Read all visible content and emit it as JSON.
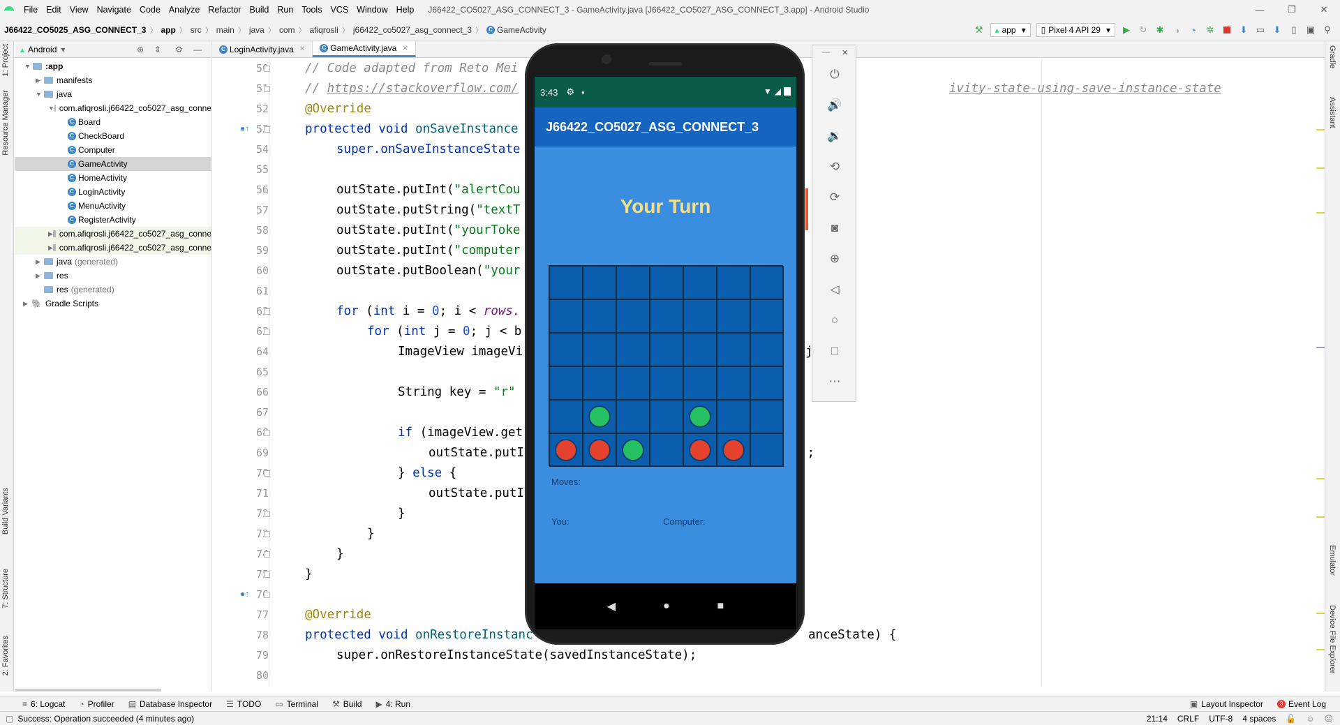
{
  "window": {
    "title": "J66422_CO5027_ASG_CONNECT_3 - GameActivity.java [J66422_CO5027_ASG_CONNECT_3.app] - Android Studio",
    "minimize": "—",
    "restore": "❐",
    "close": "✕"
  },
  "menu": [
    "File",
    "Edit",
    "View",
    "Navigate",
    "Code",
    "Analyze",
    "Refactor",
    "Build",
    "Run",
    "Tools",
    "VCS",
    "Window",
    "Help"
  ],
  "breadcrumbs": [
    "J66422_CO5025_ASG_CONNECT_3",
    "app",
    "src",
    "main",
    "java",
    "com",
    "afiqrosli",
    "j66422_co5027_asg_connect_3",
    "GameActivity"
  ],
  "toolbar": {
    "run_config": "app",
    "device": "Pixel 4 API 29"
  },
  "left_tabs": {
    "project": "1: Project",
    "resource_manager": "Resource Manager",
    "build_variants": "Build Variants",
    "structure": "7: Structure",
    "favorites": "2: Favorites"
  },
  "right_tabs": {
    "gradle": "Gradle",
    "assistant": "Assistant",
    "emulator": "Emulator",
    "device_file_explorer": "Device File Explorer"
  },
  "project": {
    "view_mode": "Android",
    "tree": [
      {
        "label": ":app",
        "bold": true
      },
      {
        "label": "manifests"
      },
      {
        "label": "java"
      },
      {
        "label": "com.afiqrosli.j66422_co5027_asg_conne"
      },
      {
        "label": "Board"
      },
      {
        "label": "CheckBoard"
      },
      {
        "label": "Computer"
      },
      {
        "label": "GameActivity"
      },
      {
        "label": "HomeActivity"
      },
      {
        "label": "LoginActivity"
      },
      {
        "label": "MenuActivity"
      },
      {
        "label": "RegisterActivity"
      },
      {
        "label": "com.afiqrosli.j66422_co5027_asg_conne"
      },
      {
        "label": "com.afiqrosli.j66422_co5027_asg_conne"
      },
      {
        "label": "java",
        "suffix": "(generated)"
      },
      {
        "label": "res"
      },
      {
        "label": "res",
        "suffix": "(generated)"
      },
      {
        "label": "Gradle Scripts"
      }
    ]
  },
  "editor_tabs": [
    {
      "label": "LoginActivity.java",
      "active": false
    },
    {
      "label": "GameActivity.java",
      "active": true
    }
  ],
  "line_numbers": [
    "50",
    "51",
    "52",
    "53",
    "54",
    "55",
    "56",
    "57",
    "58",
    "59",
    "60",
    "61",
    "62",
    "63",
    "64",
    "65",
    "66",
    "67",
    "68",
    "69",
    "70",
    "71",
    "72",
    "73",
    "74",
    "75",
    "76",
    "77",
    "78",
    "79",
    "80"
  ],
  "code": {
    "l50": "// Code adapted from Reto Mei",
    "l51a": "// ",
    "l51b": "https://stackoverflow.com/",
    "l51c": "ivity-state-using-save-instance-state",
    "l52": "@Override",
    "l53a": "protected void ",
    "l53b": "onSaveInstance",
    "l54": "super.onSaveInstanceState",
    "l56a": "outState.putInt(",
    "l56b": "\"alertCou",
    "l57a": "outState.putString(",
    "l57b": "\"textT",
    "l58a": "outState.putInt(",
    "l58b": "\"yourToke",
    "l59a": "outState.putInt(",
    "l59b": "\"computer",
    "l60a": "outState.putBoolean(",
    "l60b": "\"your",
    "l62a": "for ",
    "l62b": "(",
    "l62c": "int ",
    "l62d": "i = ",
    "l62e": "0",
    "l62f": "; i < ",
    "l62g": "rows.",
    "l63a": "for ",
    "l63b": "(",
    "l63c": "int ",
    "l63d": "j = ",
    "l63e": "0",
    "l63f": "; j < b",
    "l64": "ImageView imageVi",
    "l64b": "j",
    "l66a": "String key = ",
    "l66b": "\"r\"",
    "l68a": "if ",
    "l68b": "(imageView.get",
    "l69": "outState.putI",
    "l69b": ");",
    "l70a": "} ",
    "l70b": "else ",
    "l70c": "{",
    "l71": "outState.putI",
    "l72": "}",
    "l73": "}",
    "l74": "}",
    "l75": "}",
    "l77": "@Override",
    "l78a": "protected void ",
    "l78b": "onRestoreInstanc",
    "l78c": "anceState) {",
    "l79": "super.onRestoreInstanceState(savedInstanceState);"
  },
  "emulator": {
    "time": "3:43",
    "app_title": "J66422_CO5027_ASG_CONNECT_3",
    "turn_text": "Your Turn",
    "moves_label": "Moves:",
    "you_label": "You:",
    "computer_label": "Computer:",
    "board": [
      [
        "",
        "",
        "",
        "",
        "",
        "",
        ""
      ],
      [
        "",
        "",
        "",
        "",
        "",
        "",
        ""
      ],
      [
        "",
        "",
        "",
        "",
        "",
        "",
        ""
      ],
      [
        "",
        "",
        "",
        "",
        "",
        "",
        ""
      ],
      [
        "",
        "green",
        "",
        "",
        "green",
        "",
        ""
      ],
      [
        "red",
        "red",
        "green",
        "",
        "red",
        "red",
        ""
      ]
    ],
    "colors": {
      "red": "#e4412f",
      "green": "#25c160",
      "board": "#0b5dad",
      "background": "#3b8de0",
      "app_bar": "#1565c0"
    }
  },
  "emulator_controls": [
    "power-icon",
    "volume-up-icon",
    "volume-down-icon",
    "rotate-left-icon",
    "rotate-right-icon",
    "camera-icon",
    "zoom-icon",
    "back-icon",
    "home-icon",
    "overview-icon",
    "more-icon"
  ],
  "bottom_tools": [
    "6: Logcat",
    "Profiler",
    "Database Inspector",
    "TODO",
    "Terminal",
    "Build",
    "4: Run"
  ],
  "bottom_right": {
    "layout_inspector": "Layout Inspector",
    "event_log": "Event Log",
    "event_count": "3"
  },
  "status": {
    "message": "Success: Operation succeeded (4 minutes ago)",
    "position": "21:14",
    "line_sep": "CRLF",
    "encoding": "UTF-8",
    "indent": "4 spaces"
  }
}
